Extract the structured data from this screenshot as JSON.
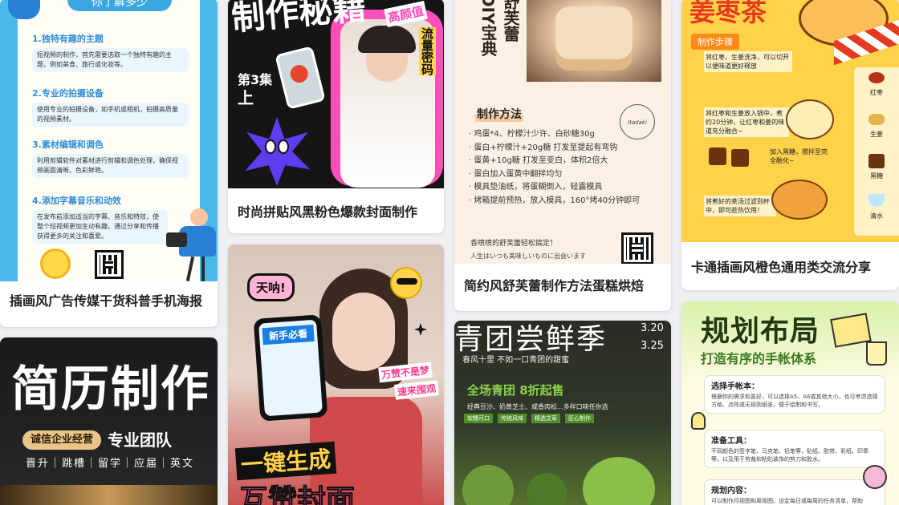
{
  "cards": [
    {
      "title": "插画风广告传媒干货科普手机海报",
      "poster": {
        "pill": "你了解多少",
        "sections": [
          {
            "h": "1.独特有趣的主题",
            "p": "短视频的制作，首先需要选取一个独特有趣的主题，例如美食、旅行或化妆等。"
          },
          {
            "h": "2.专业的拍摄设备",
            "p": "使用专业的拍摄设备，如手机或相机，拍摄高质量的视频素材。"
          },
          {
            "h": "3.素材编辑和调色",
            "p": "利用剪辑软件对素材进行剪辑和调色处理，确保视频画面清晰、色彩鲜艳。"
          },
          {
            "h": "4.添加字幕音乐和动效",
            "p": "在发布前添加适当的字幕、音乐和特效，使整个短视频更加生动有趣，通过分享和传播获得更多的关注和喜爱。"
          }
        ]
      }
    },
    {
      "title": "时尚拼贴风黑粉色爆款封面制作",
      "poster": {
        "headline": "制作秘籍",
        "tag1": "高颜值",
        "tag2": "流量密码",
        "ep": "第3集",
        "sub": "上"
      }
    },
    {
      "title": "简约风舒芙蕾制作方法蛋糕烘焙",
      "poster": {
        "vtitle": "舒芙蕾DIY宝典",
        "method": "制作方法",
        "stamp": "Itadaki",
        "steps": [
          "鸡蛋*4、柠檬汁少许、白砂糖30g",
          "蛋白+柠檬汁+20g糖 打发至提起有弯钩",
          "蛋黄+10g糖 打发至变白，体积2倍大",
          "蛋白加入蛋黄中翻拌均匀",
          "模具垫油纸，将蛋糊倒入，轻震模具",
          "烤箱提前预热，放入模具，160°烤40分钟即可"
        ],
        "footer1": "香喷喷的舒芙蕾轻松搞定！",
        "footer2": "人生はいつも美味しいものに出会います"
      }
    },
    {
      "title": "卡通插画风橙色通用类交流分享",
      "poster": {
        "headline": "姜枣茶",
        "steps_label": "制作步骤",
        "s1": "将红枣、生姜洗净，可以切开以便味道更好释放",
        "s2": "将红枣和生姜放入锅中，煮约20分钟，让红枣和姜的味道充分融合~",
        "s3": "加入黑糖，搅拌至完全融化~",
        "s4": "将煮好的茶汤过滤到杯中，即可趁热饮用！",
        "i1": "红枣",
        "i2": "生姜",
        "i3": "黑糖",
        "i4": "清水"
      }
    },
    {
      "title": "简历制作",
      "poster": {
        "headline": "简历制作",
        "badge": "诚信企业经营",
        "team": "专业团队",
        "line": "晋升｜跳槽｜留学｜应届｜英文"
      }
    },
    {
      "title": "一键生成互赞封面",
      "poster": {
        "bubble": "天呐!",
        "phone1": "新手必看",
        "right1": "万赞不是梦",
        "right2": "速来围观",
        "bottom1": "一键生成",
        "bottom2": "互赞封面"
      }
    },
    {
      "title": "青团尝鲜季",
      "poster": {
        "headline": "青团尝鲜季",
        "date1": "3.20",
        "date2": "3.25",
        "sub": "春风十里 不如一口青团的甜蜜",
        "promo": "全场青团 8折起售",
        "desc": "经典豆沙、奶黄芝士、咸香肉松...多样口味任你选",
        "tags": [
          "软糯可口",
          "传统风味",
          "精选艾草",
          "匠心制作"
        ]
      }
    },
    {
      "title": "规划布局 打造有序的手帐体系",
      "poster": {
        "headline": "规划布局",
        "sub": "打造有序的手帐体系",
        "b1h": "选择手帐本：",
        "b1p": "根据你的需求和喜好，可以选择A5、A6或其他大小，也可考虑选择方格、点阵或无规则纸张，便于绘制和书写。",
        "b2h": "准备工具：",
        "b2p": "不同颜色的签字笔、马克笔、铅笔等，贴纸、胶带、彩纸、印章等，以及用于剪裁和粘贴装饰的剪刀和胶水。",
        "b3h": "规划内容：",
        "b3p": "可以制作月视图和周视图。设定每日或每周的任务清单，帮助"
      }
    }
  ],
  "colors": {
    "accent_blue": "#3aa7e0",
    "accent_pink": "#ff4fb8",
    "accent_orange": "#ff8a1a",
    "accent_green": "#8ad14a"
  }
}
